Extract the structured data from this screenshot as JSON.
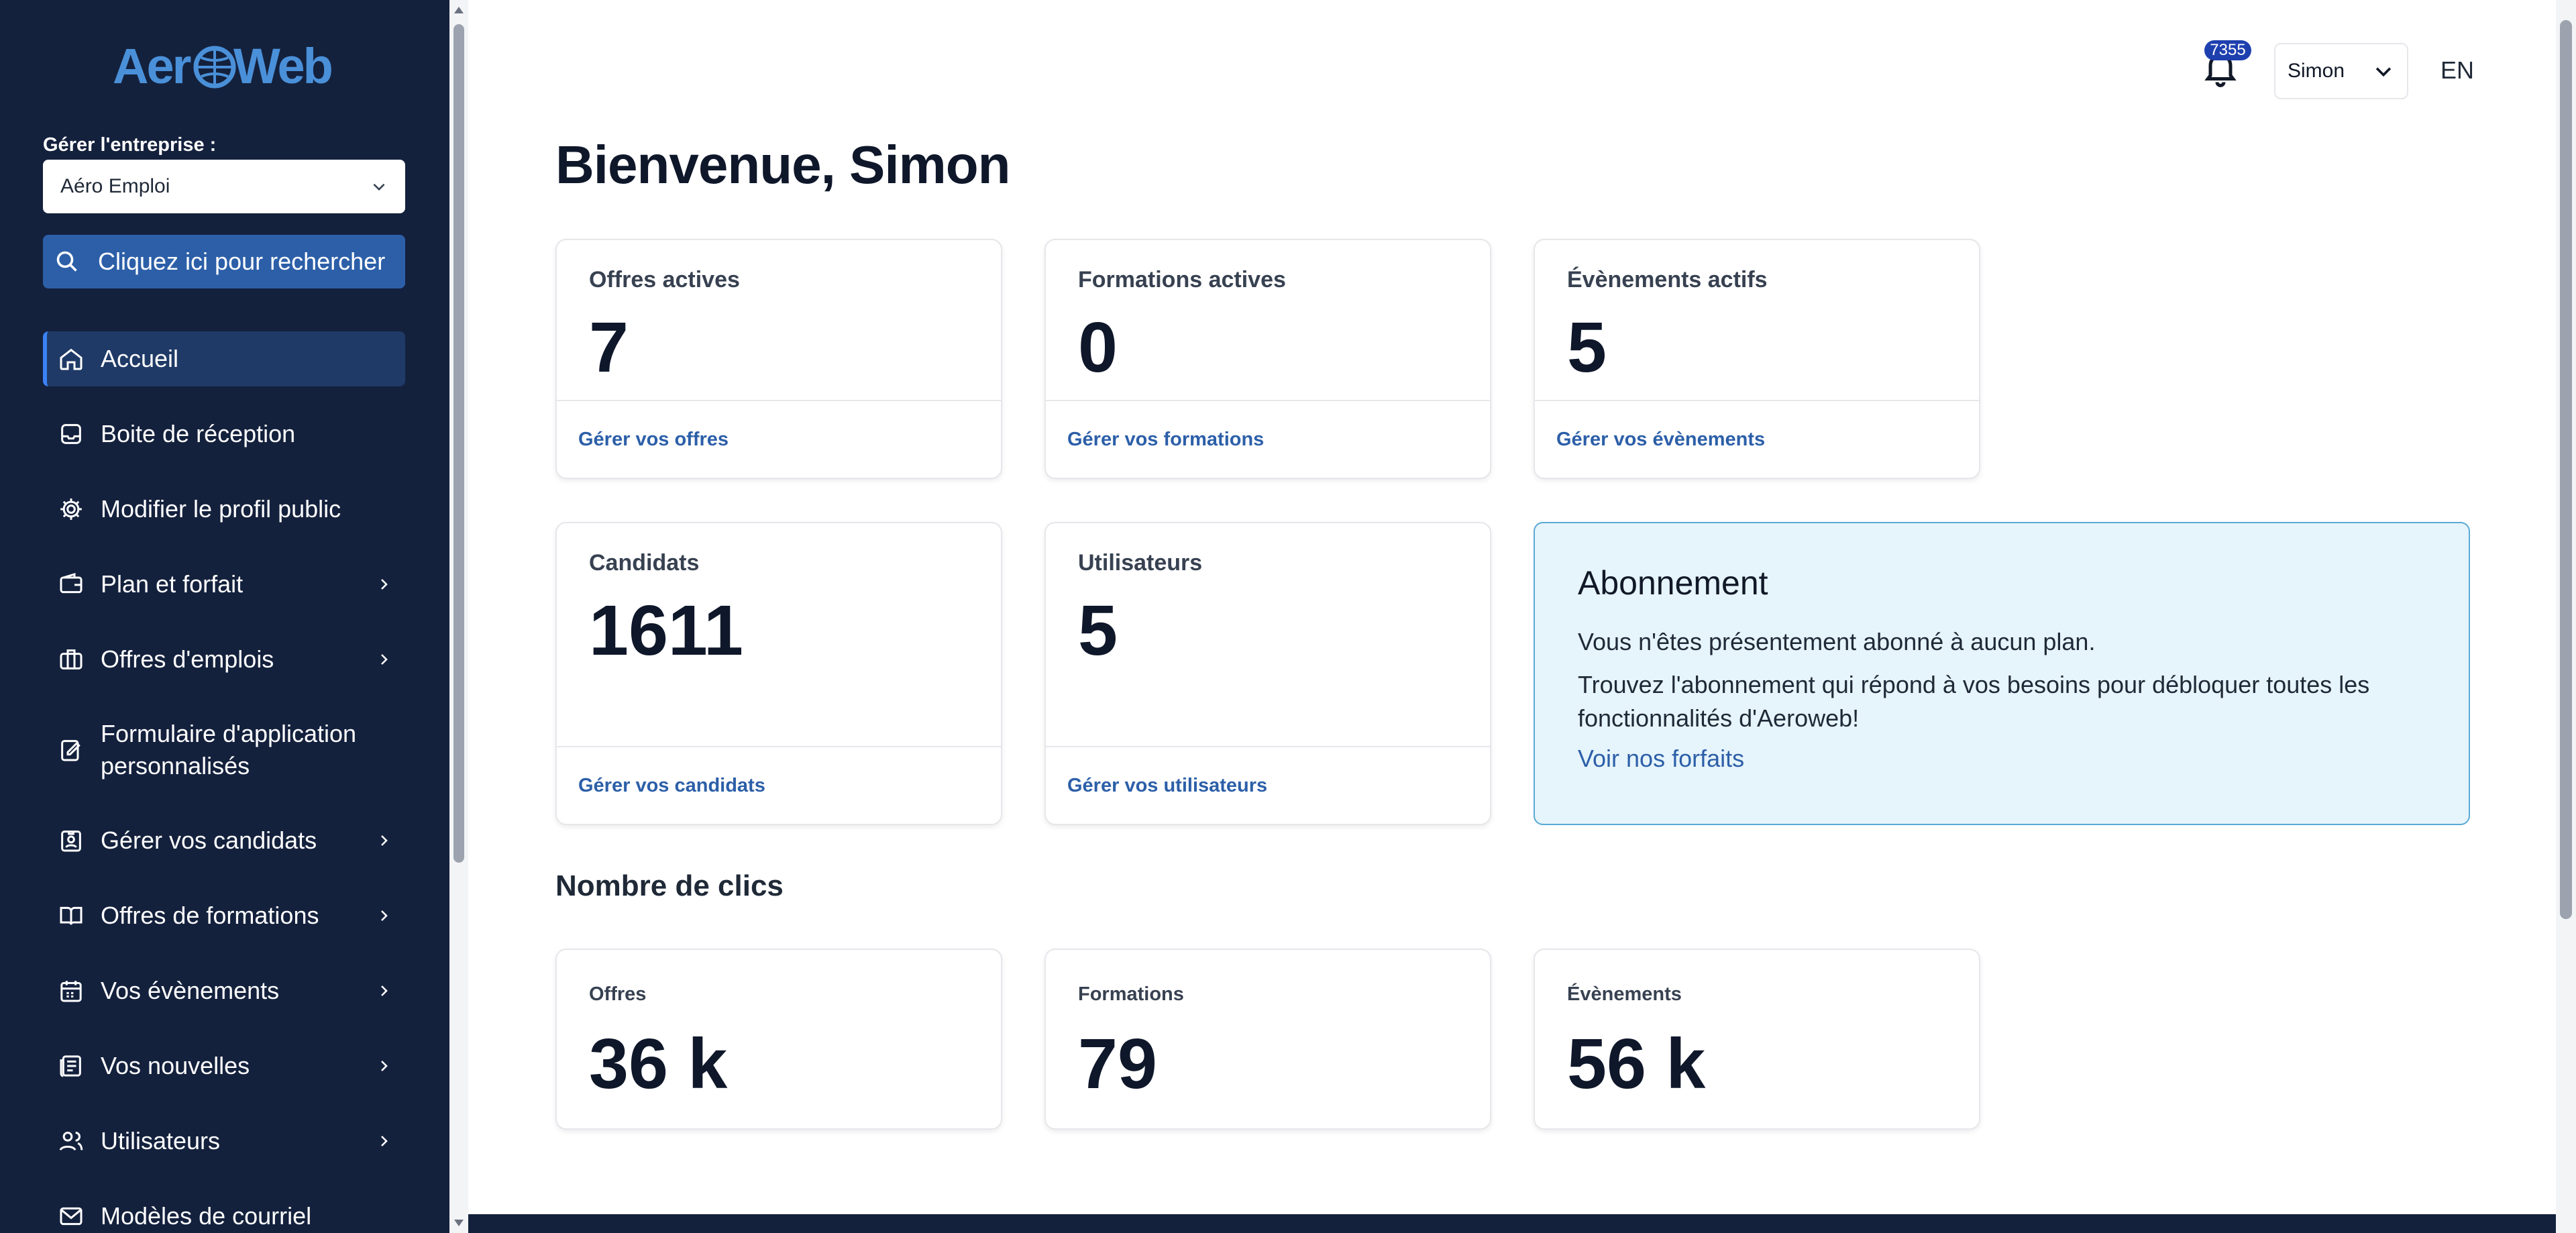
{
  "app": {
    "logo_text": "AeroWeb"
  },
  "sidebar": {
    "company_label": "Gérer l'entreprise :",
    "company_value": "Aéro Emploi",
    "search_label": "Cliquez ici pour rechercher",
    "items": [
      {
        "label": "Accueil",
        "icon": "home-icon",
        "active": true,
        "has_submenu": false
      },
      {
        "label": "Boite de réception",
        "icon": "inbox-icon",
        "has_submenu": false
      },
      {
        "label": "Modifier le profil public",
        "icon": "gear-icon",
        "has_submenu": false
      },
      {
        "label": "Plan et forfait",
        "icon": "wallet-icon",
        "has_submenu": true
      },
      {
        "label": "Offres d'emplois",
        "icon": "briefcase-icon",
        "has_submenu": true
      },
      {
        "label": "Formulaire d'application personnalisés",
        "icon": "form-edit-icon",
        "has_submenu": false
      },
      {
        "label": "Gérer vos candidats",
        "icon": "badge-icon",
        "has_submenu": true
      },
      {
        "label": "Offres de formations",
        "icon": "book-icon",
        "has_submenu": true
      },
      {
        "label": "Vos évènements",
        "icon": "calendar-icon",
        "has_submenu": true
      },
      {
        "label": "Vos nouvelles",
        "icon": "newspaper-icon",
        "has_submenu": true
      },
      {
        "label": "Utilisateurs",
        "icon": "users-icon",
        "has_submenu": true
      },
      {
        "label": "Modèles de courriel",
        "icon": "mail-icon",
        "has_submenu": false
      }
    ]
  },
  "header": {
    "notification_count": "7355",
    "user_name": "Simon",
    "language": "EN"
  },
  "main": {
    "title": "Bienvenue, Simon",
    "stats": [
      {
        "label": "Offres actives",
        "value": "7",
        "link": "Gérer vos offres"
      },
      {
        "label": "Formations actives",
        "value": "0",
        "link": "Gérer vos formations"
      },
      {
        "label": "Évènements actifs",
        "value": "5",
        "link": "Gérer vos évènements"
      },
      {
        "label": "Candidats",
        "value": "1611",
        "link": "Gérer vos candidats"
      },
      {
        "label": "Utilisateurs",
        "value": "5",
        "link": "Gérer vos utilisateurs"
      }
    ],
    "subscription": {
      "title": "Abonnement",
      "line1": "Vous n'êtes présentement abonné à aucun plan.",
      "line2": "Trouvez l'abonnement qui répond à vos besoins pour débloquer toutes les fonctionnalités d'Aeroweb!",
      "link": "Voir nos forfaits"
    },
    "clicks_title": "Nombre de clics",
    "clicks": [
      {
        "label": "Offres",
        "value": "36 k"
      },
      {
        "label": "Formations",
        "value": "79"
      },
      {
        "label": "Évènements",
        "value": "56 k"
      }
    ]
  },
  "colors": {
    "sidebar_bg": "#14213d",
    "accent": "#2c5fa8",
    "subscription_bg": "#e6f4fb",
    "subscription_border": "#5aa9d6",
    "badge": "#1e40af"
  }
}
